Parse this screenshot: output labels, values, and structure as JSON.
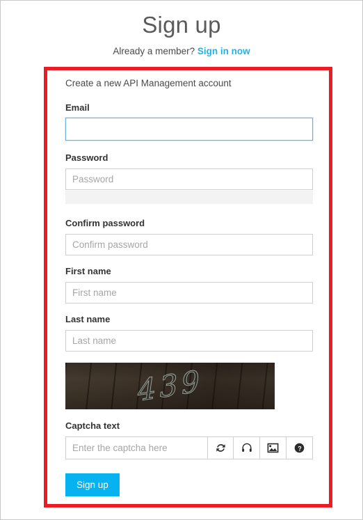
{
  "header": {
    "title": "Sign up",
    "member_prompt": "Already a member?",
    "signin_link": "Sign in now"
  },
  "form": {
    "heading": "Create a new API Management account",
    "fields": [
      {
        "label": "Email",
        "placeholder": "",
        "value": ""
      },
      {
        "label": "Password",
        "placeholder": "Password",
        "value": ""
      },
      {
        "label": "Confirm password",
        "placeholder": "Confirm password",
        "value": ""
      },
      {
        "label": "First name",
        "placeholder": "First name",
        "value": ""
      },
      {
        "label": "Last name",
        "placeholder": "Last name",
        "value": ""
      },
      {
        "label": "Captcha text",
        "placeholder": "Enter the captcha here",
        "value": ""
      }
    ],
    "captcha": {
      "image_text": "439"
    },
    "captcha_buttons": [
      {
        "icon": "refresh-icon"
      },
      {
        "icon": "headphones-icon"
      },
      {
        "icon": "image-icon"
      },
      {
        "icon": "help-icon"
      }
    ],
    "submit_label": "Sign up"
  },
  "colors": {
    "accent": "#06b3f0",
    "link": "#1eb3ec",
    "annotation": "#ec1c24",
    "focus_border": "#6cb0e6",
    "input_border": "#cfcfcf",
    "strength_bar": "#f3f3f3",
    "captcha_background": "#3b3228"
  }
}
